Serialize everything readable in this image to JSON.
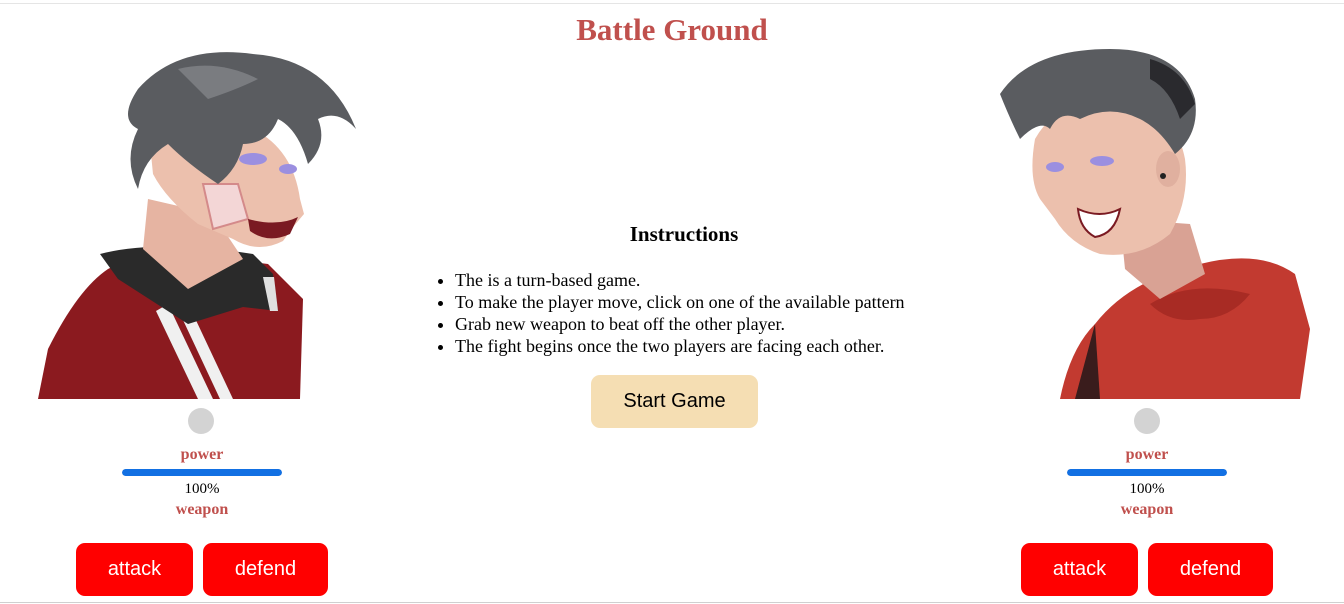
{
  "header": {
    "title": "Battle Ground"
  },
  "instructions": {
    "heading": "Instructions",
    "items": [
      "The is a turn-based game.",
      "To make the player move, click on one of the available pattern",
      "Grab new weapon to beat off the other player.",
      "The fight begins once the two players are facing each other."
    ],
    "start_label": "Start Game"
  },
  "players": [
    {
      "power_label": "power",
      "power_value": "100%",
      "power_fraction": 1.0,
      "weapon_label": "weapon",
      "attack_label": "attack",
      "defend_label": "defend"
    },
    {
      "power_label": "power",
      "power_value": "100%",
      "power_fraction": 1.0,
      "weapon_label": "weapon",
      "attack_label": "attack",
      "defend_label": "defend"
    }
  ],
  "colors": {
    "title": "#c0504d",
    "button": "#ff0000",
    "start_button": "#f5deb3",
    "power_bar": "#1270e3",
    "jacket_red": "#8b1a1f",
    "hair": "#5a5c60",
    "skin": "#e8b9a8"
  }
}
